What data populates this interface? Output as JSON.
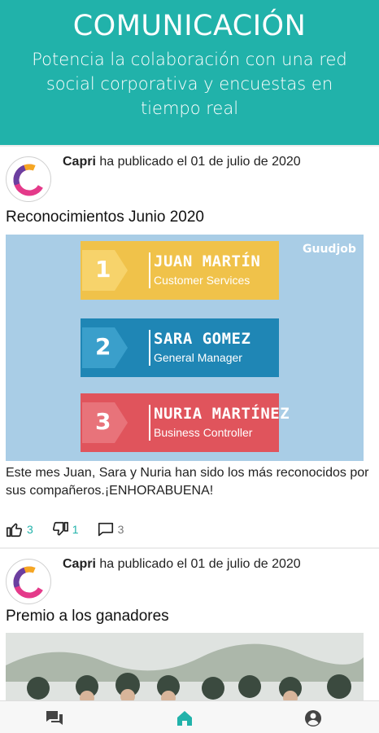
{
  "hero": {
    "title": "COMUNICACIÓN",
    "subtitle": "Potencia la colaboración con una red social corporativa y encuestas en tiempo real"
  },
  "posts": [
    {
      "author": "Capri",
      "published_text": "ha publicado el 01 de julio de 2020",
      "title": "Reconocimientos Junio 2020",
      "image": {
        "brand": "Guudjob",
        "ranks": [
          {
            "num": "1",
            "name": "JUAN MARTÍN",
            "role": "Customer Services",
            "color": "#f0c24a"
          },
          {
            "num": "2",
            "name": "SARA GOMEZ",
            "role": "General Manager",
            "color": "#1f86b5"
          },
          {
            "num": "3",
            "name": "NURIA MARTÍNEZ",
            "role": "Business Controller",
            "color": "#e0545c"
          }
        ]
      },
      "body": "Este mes Juan, Sara y Nuria han sido los más reconocidos por sus compañeros.¡ENHORABUENA!",
      "likes": "3",
      "dislikes": "1",
      "comments": "3"
    },
    {
      "author": "Capri",
      "published_text": "ha publicado el 01 de julio de 2020",
      "title": "Premio a los ganadores"
    }
  ],
  "nav": {
    "items": [
      "chat",
      "home",
      "account"
    ]
  },
  "colors": {
    "accent": "#21b2aa",
    "like": "#21b2aa"
  }
}
